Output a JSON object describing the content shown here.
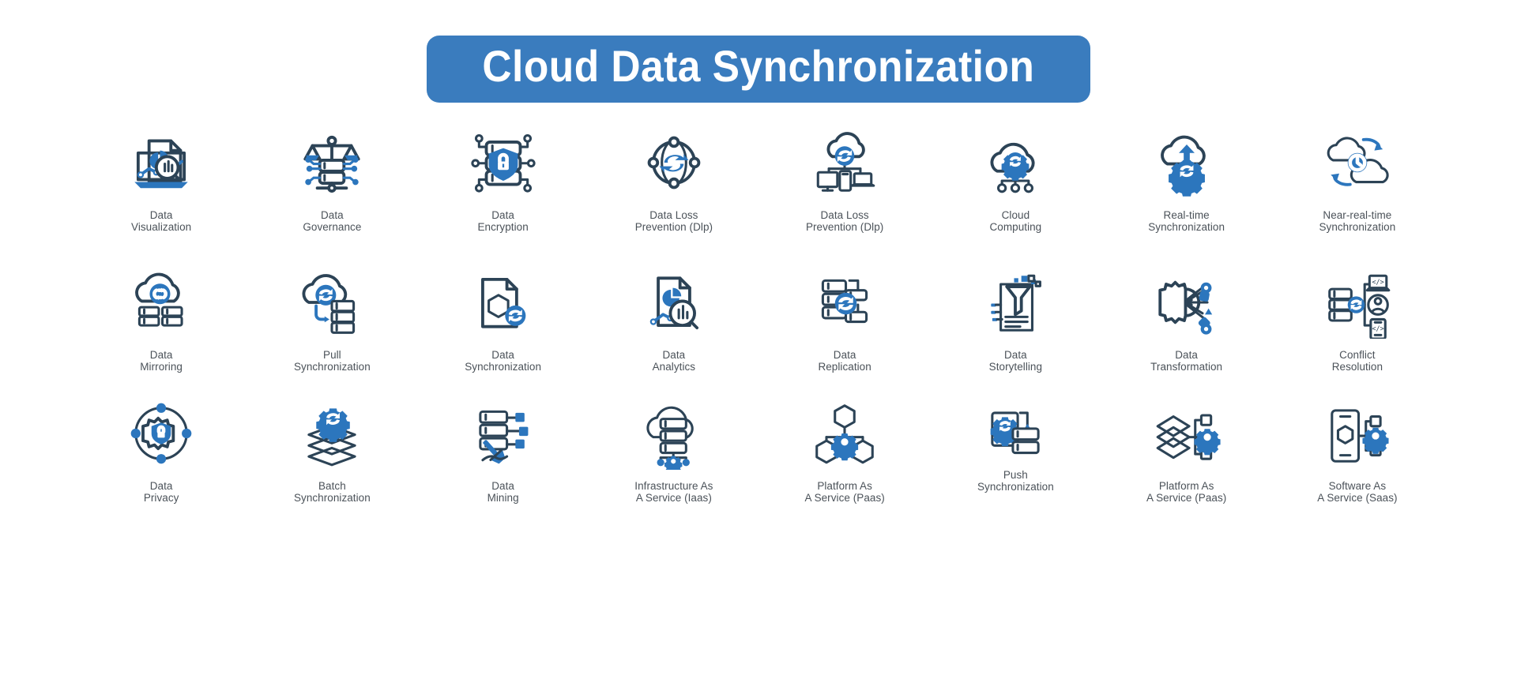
{
  "header": {
    "title": "Cloud Data Synchronization",
    "banner_color": "#3A7CBE",
    "title_color": "#FFFFFF"
  },
  "theme": {
    "outline_color": "#2C4356",
    "accent_color": "#2C76BD",
    "label_color": "#4B5259",
    "background": "#FFFFFF"
  },
  "grid": {
    "columns": 8,
    "rows": 3,
    "items": [
      {
        "icon": "data-visualization-icon",
        "line1": "Data",
        "line2": "Visualization"
      },
      {
        "icon": "data-governance-icon",
        "line1": "Data",
        "line2": "Governance"
      },
      {
        "icon": "data-encryption-icon",
        "line1": "Data",
        "line2": "Encryption"
      },
      {
        "icon": "data-loss-prevention-icon",
        "line1": "Data Loss",
        "line2": "Prevention (Dlp)"
      },
      {
        "icon": "data-loss-prevention-devices-icon",
        "line1": "Data Loss",
        "line2": "Prevention (Dlp)"
      },
      {
        "icon": "cloud-computing-icon",
        "line1": "Cloud",
        "line2": "Computing"
      },
      {
        "icon": "real-time-synchronization-icon",
        "line1": "Real-time",
        "line2": "Synchronization"
      },
      {
        "icon": "near-real-time-synchronization-icon",
        "line1": "Near-real-time",
        "line2": "Synchronization"
      },
      {
        "icon": "data-mirroring-icon",
        "line1": "Data",
        "line2": "Mirroring"
      },
      {
        "icon": "pull-synchronization-icon",
        "line1": "Pull",
        "line2": "Synchronization"
      },
      {
        "icon": "data-synchronization-icon",
        "line1": "Data",
        "line2": "Synchronization"
      },
      {
        "icon": "data-analytics-icon",
        "line1": "Data",
        "line2": "Analytics"
      },
      {
        "icon": "data-replication-icon",
        "line1": "Data",
        "line2": "Replication"
      },
      {
        "icon": "data-storytelling-icon",
        "line1": "Data",
        "line2": "Storytelling"
      },
      {
        "icon": "data-transformation-icon",
        "line1": "Data",
        "line2": "Transformation"
      },
      {
        "icon": "conflict-resolution-icon",
        "line1": "Conflict",
        "line2": "Resolution"
      },
      {
        "icon": "data-privacy-icon",
        "line1": "Data",
        "line2": "Privacy"
      },
      {
        "icon": "batch-synchronization-icon",
        "line1": "Batch",
        "line2": "Synchronization"
      },
      {
        "icon": "data-mining-icon",
        "line1": "Data",
        "line2": "Mining"
      },
      {
        "icon": "infrastructure-as-a-service-icon",
        "line1": "Infrastructure As",
        "line2": "A Service (Iaas)"
      },
      {
        "icon": "platform-as-a-service-icon",
        "line1": "Platform As",
        "line2": "A Service (Paas)"
      },
      {
        "icon": "push-synchronization-icon",
        "line1": "Push",
        "line2": "Synchronization"
      },
      {
        "icon": "platform-as-a-service-layers-icon",
        "line1": "Platform As",
        "line2": "A Service (Paas)"
      },
      {
        "icon": "software-as-a-service-icon",
        "line1": "Software As",
        "line2": "A Service (Saas)"
      }
    ]
  }
}
